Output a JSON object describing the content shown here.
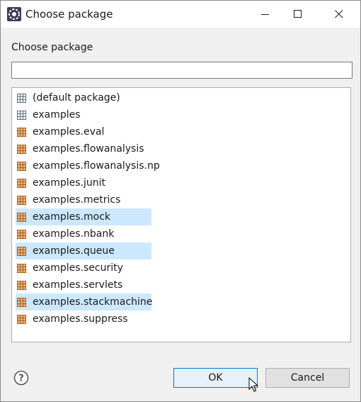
{
  "window": {
    "title": "Choose package",
    "app_icon": "eclipse-icon",
    "controls": [
      "minimize-icon",
      "maximize-icon",
      "close-icon"
    ]
  },
  "dialog": {
    "filter_label": "Choose package",
    "filter_value": "",
    "packages": [
      {
        "label": "(default package)",
        "icon": "empty-package-icon",
        "selected": false
      },
      {
        "label": "examples",
        "icon": "empty-package-icon",
        "selected": false
      },
      {
        "label": "examples.eval",
        "icon": "package-icon",
        "selected": false
      },
      {
        "label": "examples.flowanalysis",
        "icon": "package-icon",
        "selected": false
      },
      {
        "label": "examples.flowanalysis.np",
        "icon": "package-icon",
        "selected": false
      },
      {
        "label": "examples.junit",
        "icon": "package-icon",
        "selected": false
      },
      {
        "label": "examples.metrics",
        "icon": "package-icon",
        "selected": false
      },
      {
        "label": "examples.mock",
        "icon": "package-icon",
        "selected": true
      },
      {
        "label": "examples.nbank",
        "icon": "package-icon",
        "selected": false
      },
      {
        "label": "examples.queue",
        "icon": "package-icon",
        "selected": true
      },
      {
        "label": "examples.security",
        "icon": "package-icon",
        "selected": false
      },
      {
        "label": "examples.servlets",
        "icon": "package-icon",
        "selected": false
      },
      {
        "label": "examples.stackmachine",
        "icon": "package-icon",
        "selected": true
      },
      {
        "label": "examples.suppress",
        "icon": "package-icon",
        "selected": false
      }
    ]
  },
  "buttons": {
    "ok_label": "OK",
    "cancel_label": "Cancel",
    "help_icon": "help-icon"
  },
  "colors": {
    "selection": "#cce8ff",
    "ok_border": "#0078d7",
    "package_icon": "#c47a2c"
  }
}
